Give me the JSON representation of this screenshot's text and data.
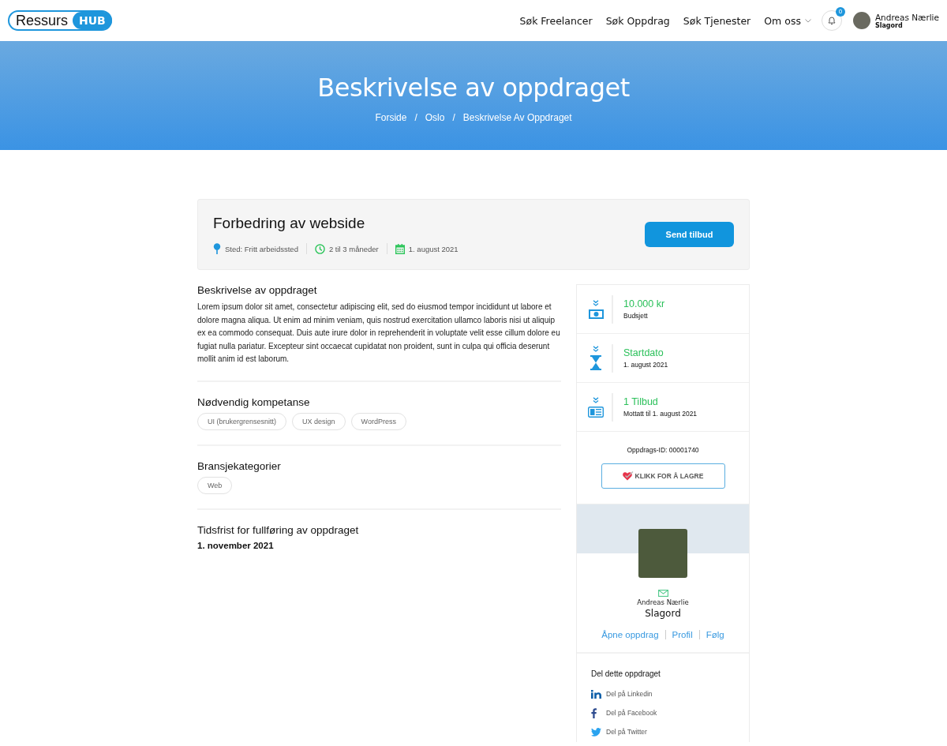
{
  "header": {
    "logo": {
      "text": "Ressurs",
      "badge": "HUB"
    },
    "nav": [
      {
        "label": "Søk Freelancer",
        "kind": "link"
      },
      {
        "label": "Søk Oppdrag",
        "kind": "link"
      },
      {
        "label": "Søk Tjenester",
        "kind": "link"
      },
      {
        "label": "Om oss",
        "kind": "dropdown"
      }
    ],
    "notifications": {
      "count": "0"
    },
    "user": {
      "name": "Andreas Nærlie",
      "subtitle": "Slagord"
    }
  },
  "hero": {
    "title": "Beskrivelse av oppdraget",
    "separator": "/",
    "breadcrumbs": [
      "Forside",
      "Oslo",
      "Beskrivelse Av Oppdraget"
    ]
  },
  "job": {
    "title": "Forbedring av webside",
    "action": "Send tilbud",
    "meta": [
      {
        "kind": "location",
        "text": "Sted: Fritt arbeidssted"
      },
      {
        "kind": "duration",
        "text": "2 til 3 måneder"
      },
      {
        "kind": "date",
        "text": "1. august 2021"
      }
    ]
  },
  "sections": [
    {
      "kind": "text",
      "heading": "Beskrivelse av oppdraget",
      "body": "Lorem ipsum dolor sit amet, consectetur adipiscing elit, sed do eiusmod tempor incididunt ut labore et dolore magna aliqua. Ut enim ad minim veniam, quis nostrud exercitation ullamco laboris nisi ut aliquip ex ea commodo consequat. Duis aute irure dolor in reprehenderit in voluptate velit esse cillum dolore eu fugiat nulla pariatur. Excepteur sint occaecat cupidatat non proident, sunt in culpa qui officia deserunt mollit anim id est laborum."
    },
    {
      "kind": "tags",
      "heading": "Nødvendig kompetanse",
      "tags": [
        "UI (brukergrensesnitt)",
        "UX design",
        "WordPress"
      ]
    },
    {
      "kind": "tags",
      "heading": "Bransjekategorier",
      "tags": [
        "Web"
      ]
    },
    {
      "kind": "date",
      "heading": "Tidsfrist for fullføring av oppdraget",
      "body": "1. november 2021"
    }
  ],
  "sidebar": {
    "stats": [
      {
        "kind": "money",
        "value": "10.000 kr",
        "label": "Budsjett"
      },
      {
        "kind": "hourglass",
        "value": "Startdato",
        "label": "1. august 2021"
      },
      {
        "kind": "offers",
        "value": "1 Tilbud",
        "label": "Mottatt til 1. august 2021"
      }
    ],
    "job_id": "Oppdrags-ID: 00001740",
    "save_button": "KLIKK FOR Å LAGRE",
    "profile": {
      "name": "Andreas Nærlie",
      "subtitle": "Slagord",
      "links": [
        "Åpne oppdrag",
        "Profil",
        "Følg"
      ]
    },
    "share": {
      "heading": "Del dette oppdraget",
      "items": [
        {
          "kind": "linkedin",
          "label": "Del på Linkedin"
        },
        {
          "kind": "facebook",
          "label": "Del på Facebook"
        },
        {
          "kind": "twitter",
          "label": "Del på Twitter"
        }
      ]
    }
  }
}
